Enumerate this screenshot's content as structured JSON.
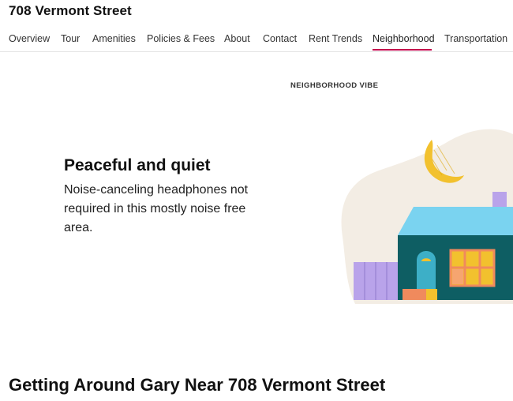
{
  "header": {
    "title": "708 Vermont Street"
  },
  "nav": {
    "items": [
      {
        "label": "Overview"
      },
      {
        "label": "Tour"
      },
      {
        "label": "Amenities"
      },
      {
        "label": "Policies & Fees"
      },
      {
        "label": "About"
      },
      {
        "label": "Contact"
      },
      {
        "label": "Rent Trends"
      },
      {
        "label": "Neighborhood"
      },
      {
        "label": "Transportation"
      }
    ],
    "active": "Neighborhood",
    "accent_color": "#c4004c"
  },
  "vibe": {
    "eyebrow": "NEIGHBORHOOD VIBE",
    "heading": "Peaceful and quiet",
    "description": "Noise-canceling headphones not required in this mostly noise free area.",
    "illustration": "house-at-night-illustration"
  },
  "transport": {
    "heading": "Getting Around Gary Near 708 Vermont Street"
  }
}
